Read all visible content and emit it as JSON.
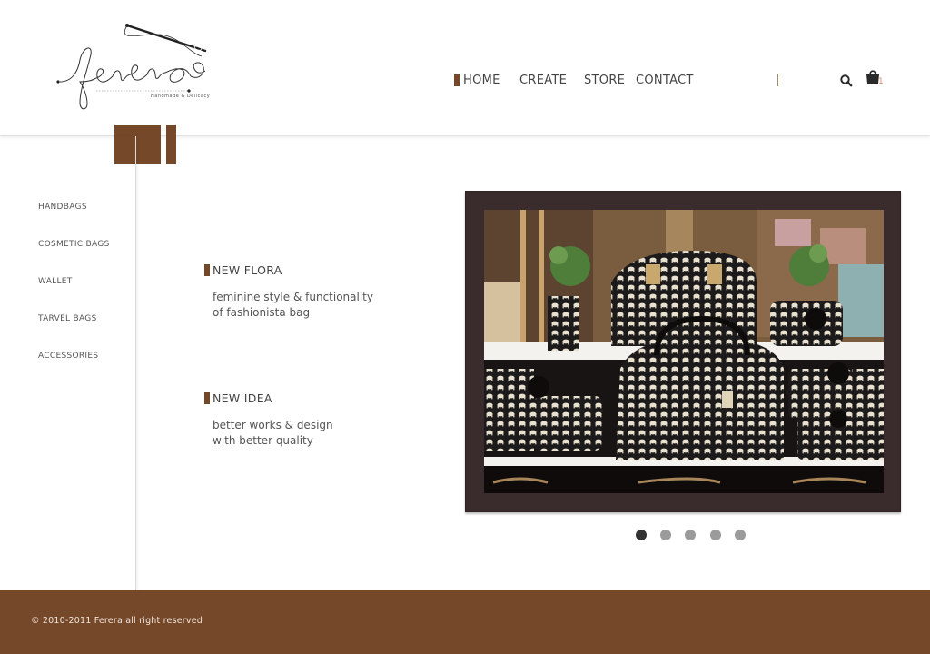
{
  "brand": {
    "name": "ferera",
    "tagline": "Handmade & Delicacy"
  },
  "nav": {
    "items": [
      {
        "label": "HOME",
        "active": true
      },
      {
        "label": "CREATE",
        "active": false
      },
      {
        "label": "STORE",
        "active": false
      },
      {
        "label": "CONTACT",
        "active": false
      }
    ],
    "search_icon": "search-icon",
    "cart_icon": "shopping-bag-icon",
    "cart_count": "1"
  },
  "sidebar": {
    "items": [
      {
        "label": "HANDBAGS"
      },
      {
        "label": "COSMETIC BAGS"
      },
      {
        "label": "WALLET"
      },
      {
        "label": "TARVEL BAGS"
      },
      {
        "label": "ACCESSORIES"
      }
    ]
  },
  "features": [
    {
      "title": "NEW FLORA",
      "line1": "feminine style & functionality",
      "line2": "of fashionista bag"
    },
    {
      "title": "NEW IDEA",
      "line1": "better works & design",
      "line2": "with better quality"
    }
  ],
  "slideshow": {
    "slide_count": 5,
    "active_index": 0
  },
  "footer": {
    "copyright": "© 2010-2011 Ferera all right reserved"
  },
  "colors": {
    "accent": "#76482a",
    "frame": "#3a2c2c",
    "dot_active": "#333333",
    "dot_inactive": "#9b9b9b"
  }
}
